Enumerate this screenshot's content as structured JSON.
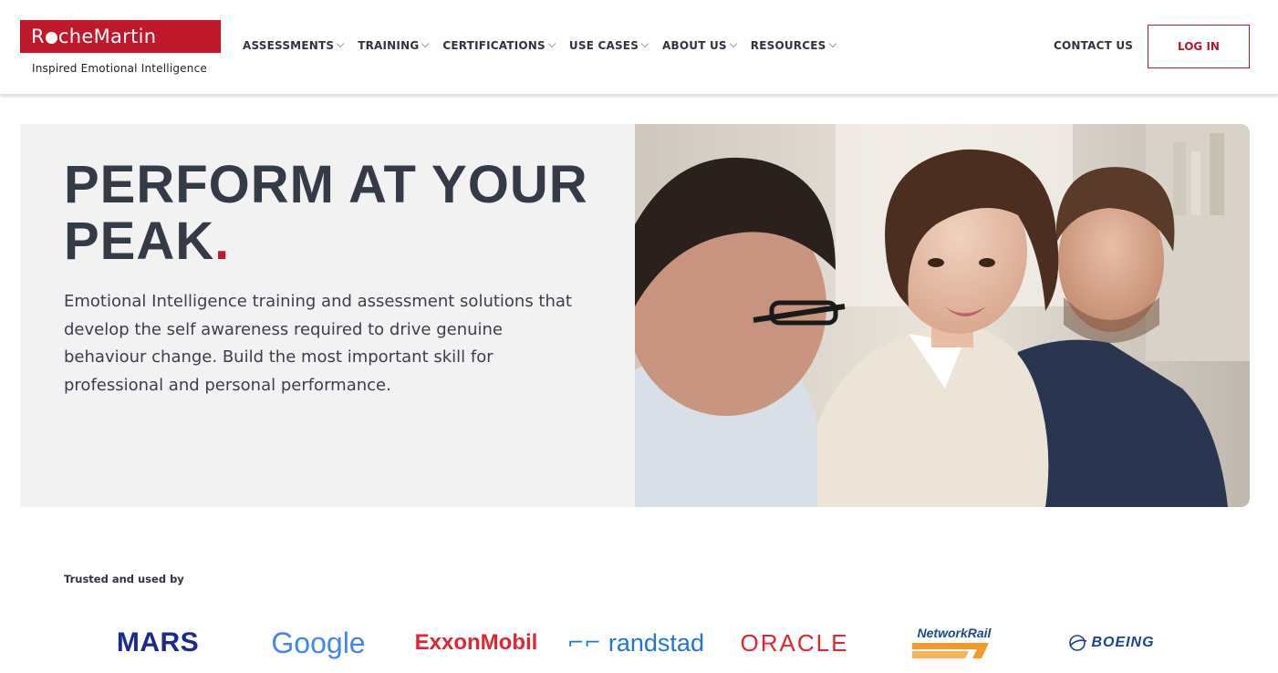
{
  "logo": {
    "name_part1": "R",
    "name_part2": "cheMartin",
    "tagline": "Inspired Emotional Intelligence"
  },
  "nav": [
    {
      "label": "ASSESSMENTS"
    },
    {
      "label": "TRAINING"
    },
    {
      "label": "CERTIFICATIONS"
    },
    {
      "label": "USE CASES"
    },
    {
      "label": "ABOUT US"
    },
    {
      "label": "RESOURCES"
    }
  ],
  "header": {
    "contact": "CONTACT US",
    "login": "LOG IN"
  },
  "hero": {
    "title_line1": "PERFORM AT YOUR",
    "title_line2": "PEAK",
    "title_accent": ".",
    "description": "Emotional Intelligence training and assessment solutions that develop the self awareness required to drive genuine behaviour change. Build the most important skill for professional and personal performance."
  },
  "trusted": {
    "label": "Trusted and used by",
    "brands": [
      "MARS",
      "Google",
      "ExxonMobil",
      "randstad",
      "ORACLE",
      "NetworkRail",
      "BOEING"
    ]
  },
  "colors": {
    "brand_red": "#c0182b",
    "text_dark": "#353a47",
    "hero_bg": "#f2f2f2"
  }
}
